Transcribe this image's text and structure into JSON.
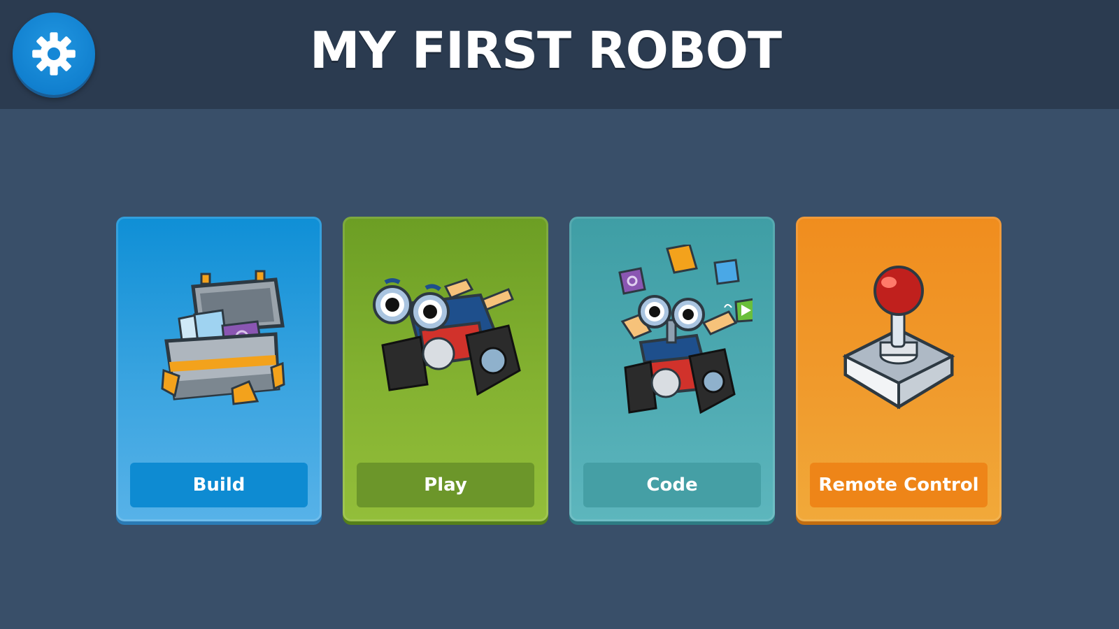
{
  "header": {
    "title": "MY FIRST ROBOT",
    "settings_icon": "gear-icon"
  },
  "menu": {
    "cards": [
      {
        "label": "Build",
        "icon": "toolbox-icon",
        "color": "#0f8fd6"
      },
      {
        "label": "Play",
        "icon": "robot-tank-icon",
        "color": "#7ba82c"
      },
      {
        "label": "Code",
        "icon": "robot-code-icon",
        "color": "#4ea9b0"
      },
      {
        "label": "Remote Control",
        "icon": "joystick-icon",
        "color": "#f0931f"
      }
    ]
  },
  "colors": {
    "background": "#394f69",
    "header": "#2b3b50",
    "settings_button": "#1587d6"
  }
}
